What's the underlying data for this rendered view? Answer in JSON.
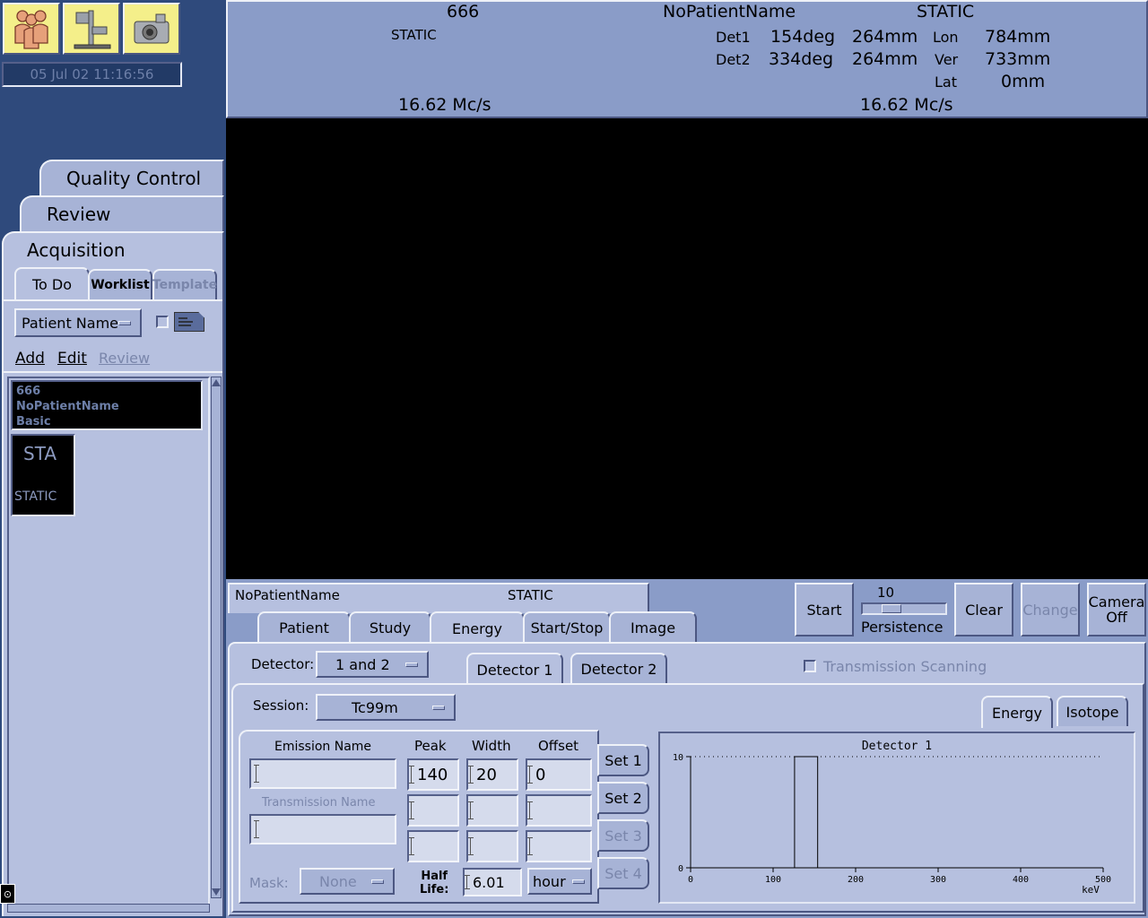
{
  "clock": "05 Jul 02 11:16:56",
  "toolbar_icons": [
    "patients-icon",
    "gantry-icon",
    "camera-icon"
  ],
  "header": {
    "left_id": "666",
    "left_mode": "STATIC",
    "patient_name": "NoPatientName",
    "right_mode": "STATIC",
    "det1_label": "Det1",
    "det1_angle": "154deg",
    "det1_radius": "264mm",
    "det2_label": "Det2",
    "det2_angle": "334deg",
    "det2_radius": "264mm",
    "lon_label": "Lon",
    "lon_value": "784mm",
    "ver_label": "Ver",
    "ver_value": "733mm",
    "lat_label": "Lat",
    "lat_value": "0mm",
    "count_rate_left": "16.62 Mc/s",
    "count_rate_right": "16.62 Mc/s"
  },
  "left_tabs": {
    "quality_control": "Quality Control",
    "review": "Review",
    "acquisition": "Acquisition"
  },
  "sub_tabs": {
    "todo": "To Do",
    "worklist": "Worklist",
    "template": "Template"
  },
  "sort": {
    "selected": "Patient Name"
  },
  "actions": {
    "add": "Add",
    "edit": "Edit",
    "review": "Review"
  },
  "patient_entry": {
    "id": "666",
    "name": "NoPatientName",
    "protocol": "Basic"
  },
  "protocol_thumb": {
    "short": "STA",
    "full": "STATIC"
  },
  "acq_header": {
    "patient": "NoPatientName",
    "mode": "STATIC"
  },
  "acq_tabs": [
    "Patient",
    "Study",
    "Energy",
    "Start/Stop",
    "Image"
  ],
  "controls": {
    "start": "Start",
    "persistence_value": "10",
    "persistence_label": "Persistence",
    "persistence_level": 0.3,
    "clear": "Clear",
    "change": "Change",
    "camera_off_1": "Camera",
    "camera_off_2": "Off"
  },
  "detector": {
    "label": "Detector:",
    "selected": "1 and 2",
    "tab1": "Detector 1",
    "tab2": "Detector 2",
    "transmission_scanning": "Transmission Scanning"
  },
  "session": {
    "label": "Session:",
    "selected": "Tc99m"
  },
  "energy_tabs": {
    "energy": "Energy",
    "isotope": "Isotope"
  },
  "energy_table": {
    "emission_name_label": "Emission Name",
    "transmission_name_label": "Transmission Name",
    "peak_label": "Peak",
    "width_label": "Width",
    "offset_label": "Offset",
    "row1": {
      "peak": "140",
      "width": "20",
      "offset": "0"
    },
    "sets": [
      "Set 1",
      "Set 2",
      "Set 3",
      "Set 4"
    ],
    "mask_label": "Mask:",
    "mask_selected": "None",
    "half_life_label_1": "Half",
    "half_life_label_2": "Life:",
    "half_life_value": "6.01",
    "half_life_unit": "hour"
  },
  "chart_data": {
    "type": "line",
    "title": "Detector 1",
    "xlabel": "keV",
    "ylabel": "",
    "xlim": [
      0,
      500
    ],
    "ylim": [
      0,
      10
    ],
    "xticks": [
      "0",
      "100",
      "200",
      "300",
      "400",
      "500"
    ],
    "yticks": [
      "0",
      "10"
    ],
    "window": {
      "lower": 126,
      "upper": 154
    },
    "series": [
      {
        "x": [
          0,
          126,
          126,
          154,
          154,
          500
        ],
        "y": [
          0,
          0,
          10,
          10,
          0,
          0
        ]
      }
    ]
  }
}
